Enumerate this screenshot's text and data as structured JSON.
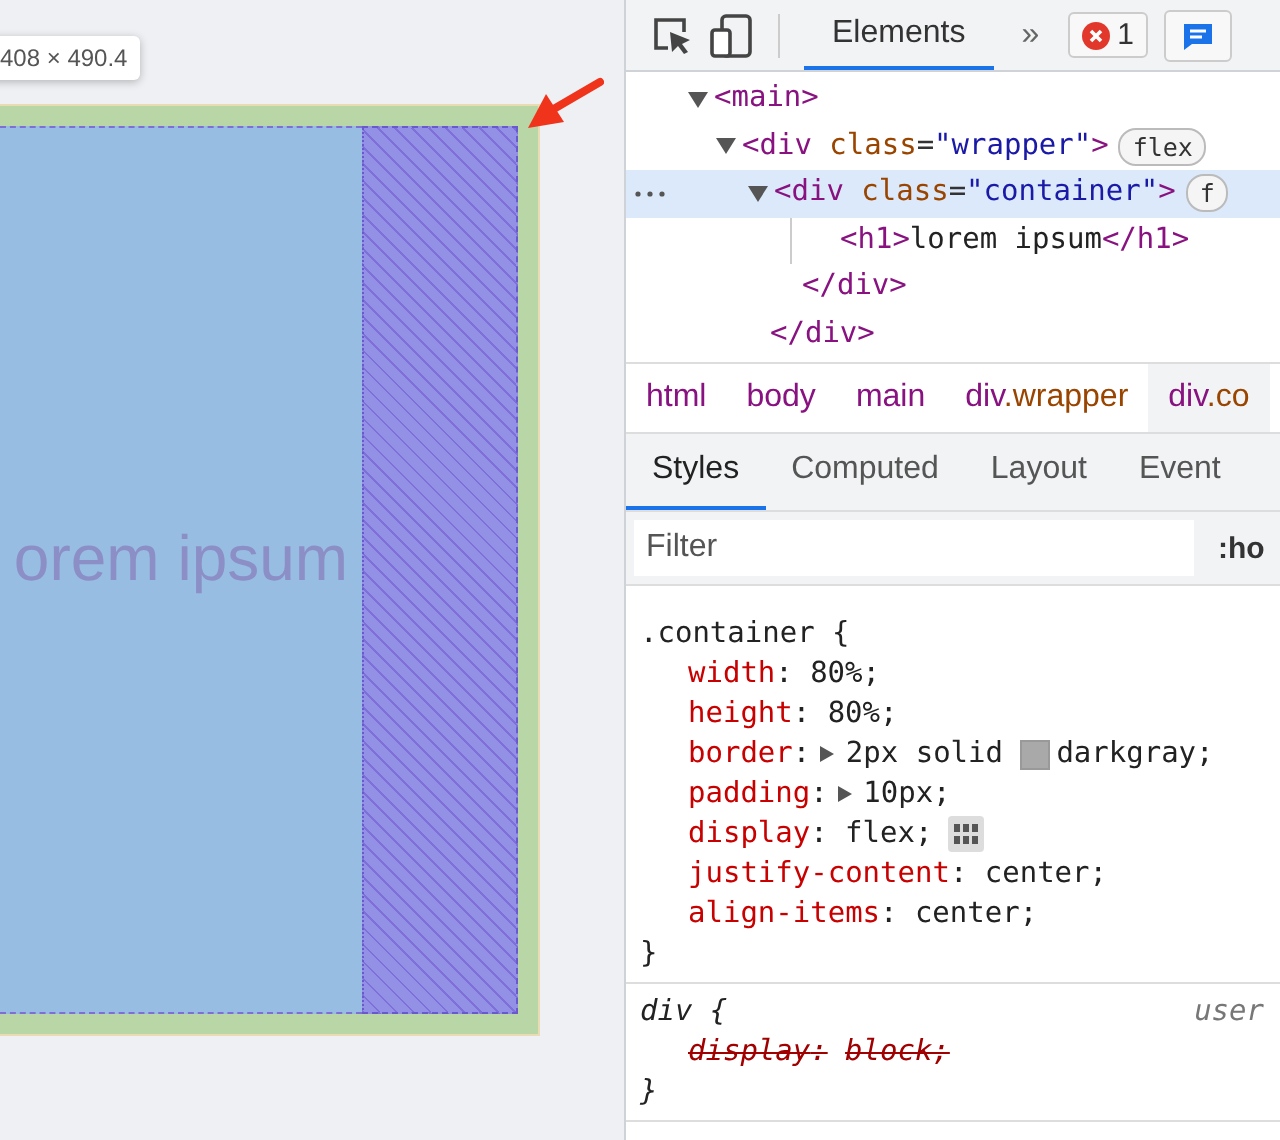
{
  "viewport": {
    "size_tooltip": "408 × 490.4",
    "heading": "orem ipsum"
  },
  "toolbar": {
    "tabs": [
      {
        "label": "Elements",
        "selected": true
      }
    ],
    "more": "»",
    "error_count": "1"
  },
  "dom_tree": [
    {
      "tokens": [
        {
          "kind": "tag",
          "text": "<main>"
        }
      ],
      "expanded": true,
      "selected": false,
      "children": [
        {
          "tokens": [
            {
              "kind": "tag",
              "text": "<div"
            },
            {
              "kind": "attr",
              "text": " class"
            },
            {
              "kind": "punct",
              "text": "="
            },
            {
              "kind": "value",
              "text": "\"wrapper\""
            },
            {
              "kind": "tag",
              "text": ">"
            }
          ],
          "badge": "flex",
          "expanded": true,
          "selected": false,
          "close": "</div>",
          "children": [
            {
              "tokens": [
                {
                  "kind": "tag",
                  "text": "<div"
                },
                {
                  "kind": "attr",
                  "text": " class"
                },
                {
                  "kind": "punct",
                  "text": "="
                },
                {
                  "kind": "value",
                  "text": "\"container\""
                },
                {
                  "kind": "tag",
                  "text": ">"
                }
              ],
              "badge": "f",
              "expanded": true,
              "selected": true,
              "close": "</div>",
              "children": [
                {
                  "tokens": [
                    {
                      "kind": "tag",
                      "text": "<h1>"
                    },
                    {
                      "kind": "text",
                      "text": "lorem ipsum"
                    },
                    {
                      "kind": "tag",
                      "text": "</h1>"
                    }
                  ],
                  "selected": false
                }
              ]
            }
          ]
        }
      ]
    }
  ],
  "breadcrumbs": [
    {
      "tag": "html",
      "selected": false
    },
    {
      "tag": "body",
      "selected": false
    },
    {
      "tag": "main",
      "selected": false
    },
    {
      "tag": "div",
      "cls": ".wrapper",
      "selected": false
    },
    {
      "tag": "div",
      "cls": ".co",
      "selected": true
    }
  ],
  "style_tabs": [
    {
      "label": "Styles",
      "selected": true
    },
    {
      "label": "Computed",
      "selected": false
    },
    {
      "label": "Layout",
      "selected": false
    },
    {
      "label": "Event",
      "selected": false
    }
  ],
  "filter": {
    "placeholder": "Filter",
    "hov": ":ho"
  },
  "rules": [
    {
      "selector": ".container {",
      "italic": false,
      "close": "}",
      "declarations": [
        {
          "name": "width",
          "sep": ":",
          "value": "80%;",
          "expandable": false,
          "flex_editor": false,
          "overridden": false
        },
        {
          "name": "height",
          "sep": ":",
          "value": "80%;",
          "expandable": false,
          "flex_editor": false,
          "overridden": false
        },
        {
          "name": "border",
          "sep": ":",
          "value": "2px solid",
          "swatch": true,
          "value_after": "darkgray;",
          "expandable": true,
          "flex_editor": false,
          "overridden": false
        },
        {
          "name": "padding",
          "sep": ":",
          "value": "10px;",
          "expandable": true,
          "flex_editor": false,
          "overridden": false
        },
        {
          "name": "display",
          "sep": ":",
          "value": "flex;",
          "flex_editor": true,
          "expandable": false,
          "overridden": false
        },
        {
          "name": "justify-content",
          "sep": ":",
          "value": "center;",
          "expandable": false,
          "flex_editor": false,
          "overridden": false
        },
        {
          "name": "align-items",
          "sep": ":",
          "value": "center;",
          "expandable": false,
          "flex_editor": false,
          "overridden": false
        }
      ]
    },
    {
      "selector": "div {",
      "italic": true,
      "origin": "user",
      "close": "}",
      "declarations": [
        {
          "name": "display",
          "sep": ":",
          "value": "block;",
          "expandable": false,
          "flex_editor": false,
          "overridden": true
        }
      ]
    }
  ]
}
